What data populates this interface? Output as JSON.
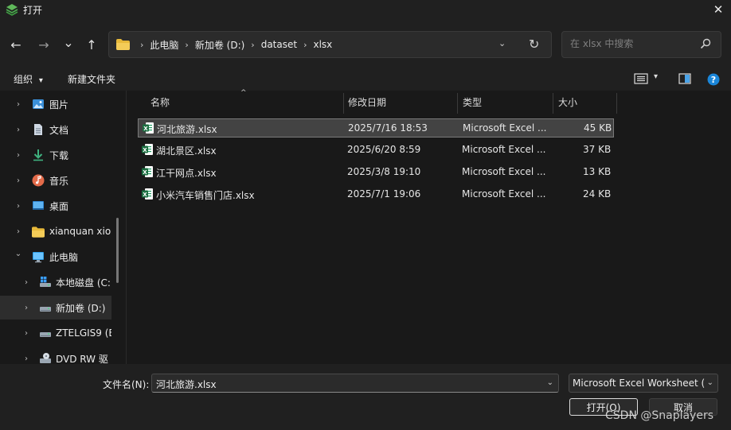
{
  "window": {
    "title": "打开",
    "close_glyph": "✕"
  },
  "nav": {
    "back_glyph": "←",
    "forward_glyph": "→",
    "recent_glyph": "⌄",
    "up_glyph": "↑",
    "breadcrumbs": [
      "此电脑",
      "新加卷 (D:)",
      "dataset",
      "xlsx"
    ],
    "crumb_sep": "›",
    "refresh_glyph": "↻",
    "dropdown_glyph": "⌄",
    "search_placeholder": "在 xlsx 中搜索"
  },
  "toolbar": {
    "organize_label": "组织",
    "organize_arrow": "▾",
    "new_folder_label": "新建文件夹",
    "view_arrow": "▾"
  },
  "sidebar": {
    "items": [
      {
        "label": "图片",
        "icon": "pictures-icon",
        "chevron": "›"
      },
      {
        "label": "文档",
        "icon": "documents-icon",
        "chevron": "›"
      },
      {
        "label": "下载",
        "icon": "downloads-icon",
        "chevron": "›"
      },
      {
        "label": "音乐",
        "icon": "music-icon",
        "chevron": "›"
      },
      {
        "label": "桌面",
        "icon": "desktop-icon",
        "chevron": "›"
      },
      {
        "label": "xianquan xion",
        "icon": "user-folder-icon",
        "chevron": "›"
      },
      {
        "label": "此电脑",
        "icon": "this-pc-icon",
        "chevron": "⌄"
      },
      {
        "label": "本地磁盘 (C:",
        "icon": "system-drive-icon",
        "chevron": "›"
      },
      {
        "label": "新加卷 (D:)",
        "icon": "drive-icon",
        "chevron": "›"
      },
      {
        "label": "ZTELGIS9 (E",
        "icon": "drive-icon",
        "chevron": "›"
      },
      {
        "label": "DVD RW 驱",
        "icon": "dvd-drive-icon",
        "chevron": "›"
      }
    ]
  },
  "files": {
    "columns": [
      "名称",
      "修改日期",
      "类型",
      "大小"
    ],
    "sort_arrow": "^",
    "rows": [
      {
        "name": "河北旅游.xlsx",
        "date": "2025/7/16 18:53",
        "type": "Microsoft Excel ...",
        "size": "45 KB"
      },
      {
        "name": "湖北景区.xlsx",
        "date": "2025/6/20 8:59",
        "type": "Microsoft Excel ...",
        "size": "37 KB"
      },
      {
        "name": "江干网点.xlsx",
        "date": "2025/3/8 19:10",
        "type": "Microsoft Excel ...",
        "size": "13 KB"
      },
      {
        "name": "小米汽车销售门店.xlsx",
        "date": "2025/7/1 19:06",
        "type": "Microsoft Excel ...",
        "size": "24 KB"
      }
    ],
    "excel_badge": "X"
  },
  "bottom": {
    "filename_label": "文件名(N):",
    "filename_value": "河北旅游.xlsx",
    "filetype_value": "Microsoft Excel Worksheet (",
    "dropdown_glyph": "⌄",
    "open_label": "打开(O)",
    "cancel_label": "取消",
    "watermark": "CSDN @Snaplayers"
  },
  "colors": {
    "accent": "#0078d4",
    "excel_green": "#1d6f42",
    "folder_yellow": "#f0c040"
  }
}
